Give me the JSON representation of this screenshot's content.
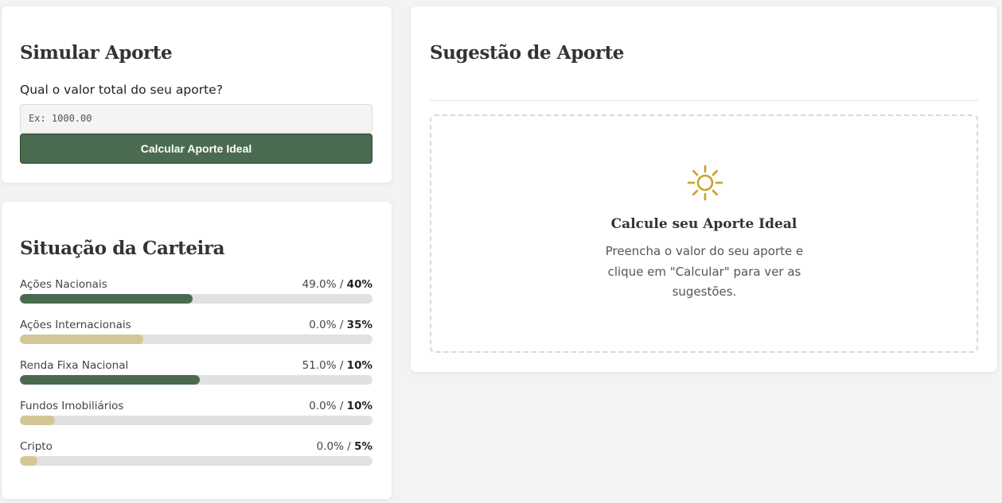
{
  "simulate": {
    "title": "Simular Aporte",
    "question": "Qual o valor total do seu aporte?",
    "input_placeholder": "Ex: 1000.00",
    "input_value": "",
    "button_label": "Calcular Aporte Ideal"
  },
  "portfolio": {
    "title": "Situação da Carteira",
    "separator": " / ",
    "items": [
      {
        "name": "Ações Nacionais",
        "current": "49.0%",
        "target": "40%",
        "bar_fill_fraction": 0.49,
        "bar_color": "#4a6b50"
      },
      {
        "name": "Ações Internacionais",
        "current": "0.0%",
        "target": "35%",
        "bar_fill_fraction": 0.35,
        "bar_color": "#d4c796"
      },
      {
        "name": "Renda Fixa Nacional",
        "current": "51.0%",
        "target": "10%",
        "bar_fill_fraction": 0.51,
        "bar_color": "#4a6b50"
      },
      {
        "name": "Fundos Imobiliários",
        "current": "0.0%",
        "target": "10%",
        "bar_fill_fraction": 0.1,
        "bar_color": "#d4c796"
      },
      {
        "name": "Cripto",
        "current": "0.0%",
        "target": "5%",
        "bar_fill_fraction": 0.05,
        "bar_color": "#d4c796"
      }
    ]
  },
  "suggestion": {
    "title": "Sugestão de Aporte",
    "empty_title": "Calcule seu Aporte Ideal",
    "empty_text": "Preencha o valor do seu aporte e clique em \"Calcular\" para ver as sugestões.",
    "icon": "sun-icon",
    "icon_color": "#c9a227"
  },
  "colors": {
    "accent": "#4a6b50",
    "target_fill": "#d4c796",
    "track": "#e1e1e1",
    "background": "#f3f3f3"
  }
}
